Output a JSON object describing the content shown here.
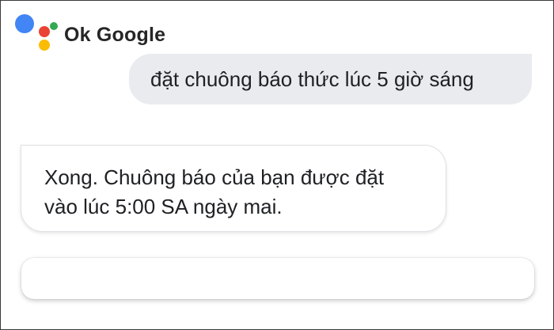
{
  "header": {
    "title": "Ok Google",
    "logo_colors": {
      "blue": "#4285F4",
      "red": "#EA4335",
      "yellow": "#FBBC05",
      "green": "#34A853"
    }
  },
  "conversation": {
    "user_message": "đặt chuông báo thức lúc 5 giờ sáng",
    "assistant_message_line1": "Xong. Chuông báo của bạn được đặt",
    "assistant_message_line2": "vào lúc 5:00 SA ngày mai."
  },
  "input_card": {
    "value": ""
  }
}
